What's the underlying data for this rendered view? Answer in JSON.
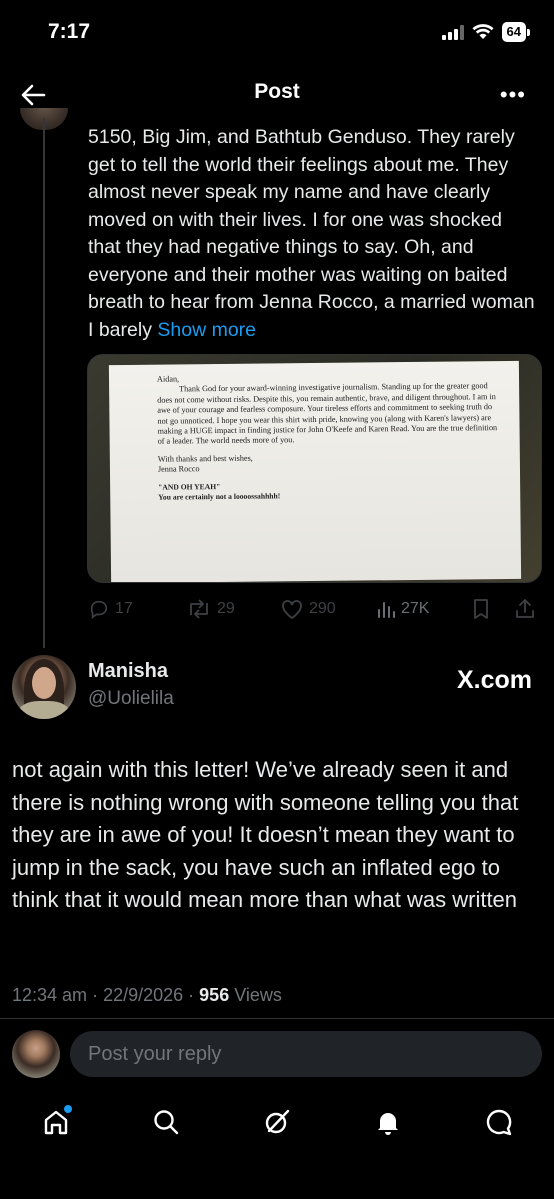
{
  "status_bar": {
    "time": "7:17",
    "battery": "64"
  },
  "header": {
    "title": "Post",
    "more": "•••"
  },
  "quoted_post": {
    "text": "5150, Big Jim, and Bathtub Genduso. They rarely get to tell the world their feelings about me. They almost never speak my name and have clearly moved on with their lives. I for one was shocked that they had negative things to say. Oh, and everyone and their mother was waiting on baited breath to hear from Jenna Rocco, a married woman I barely",
    "show_more": "Show more",
    "letter": {
      "salutation": "Aidan,",
      "body": "Thank God for your award-winning investigative journalism. Standing up for the greater good does not come without risks. Despite this, you remain authentic, brave, and diligent throughout. I am in awe of your courage and fearless composure. Your tireless efforts and commitment to seeking truth do not go unnoticed. I hope you wear this shirt with pride, knowing you (along with Karen's lawyers) are making a HUGE impact in finding justice for John O'Keefe and Karen Read. You are the true definition of a leader. The world needs more of you.",
      "closing": "With thanks and best wishes,",
      "signature": "Jenna Rocco",
      "ps1": "\"AND OH YEAH\"",
      "ps2": "You are certainly not a loooossahhhh!"
    },
    "stats": {
      "replies": "17",
      "reposts": "29",
      "likes": "290",
      "views": "27K"
    }
  },
  "reply_post": {
    "author_name": "Manisha",
    "author_handle": "@Uolielila",
    "source": "X.com",
    "text": "not again with this letter! We’ve already seen it and there is nothing wrong with someone telling you that they are in awe of you! It doesn’t mean they want to jump in the sack, you have such an inflated ego to think that it would mean more than what was written",
    "time": "12:34 am",
    "date": "22/9/2026",
    "views_count": "956",
    "views_label": "Views"
  },
  "composer": {
    "placeholder": "Post your reply"
  },
  "colors": {
    "accent": "#1d9bf0",
    "background": "#000000",
    "muted": "#71767b"
  },
  "tabbar": [
    "home-icon",
    "search-icon",
    "grok-icon",
    "notifications-icon",
    "messages-icon"
  ]
}
